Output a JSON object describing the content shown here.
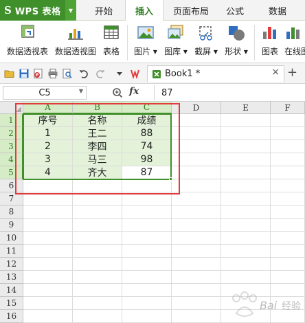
{
  "app": {
    "logo": "S",
    "name": "WPS 表格"
  },
  "tabs": [
    {
      "label": "开始"
    },
    {
      "label": "插入"
    },
    {
      "label": "页面布局"
    },
    {
      "label": "公式"
    },
    {
      "label": "数据"
    }
  ],
  "ribbon": {
    "pivot_table": "数据透视表",
    "pivot_chart": "数据透视图",
    "table": "表格",
    "picture": "图片",
    "gallery": "图库",
    "screenshot": "截屏",
    "shapes": "形状",
    "chart": "图表",
    "online": "在线图"
  },
  "document": {
    "tab_label": "Book1 *",
    "close": "×",
    "new_tab": "+"
  },
  "formula_bar": {
    "cell_ref": "C5",
    "fx": "fx",
    "value": "87"
  },
  "grid": {
    "columns": [
      "A",
      "B",
      "C",
      "D",
      "E",
      "F"
    ],
    "rows": [
      "1",
      "2",
      "3",
      "4",
      "5",
      "6",
      "7",
      "8",
      "9",
      "10",
      "11",
      "12",
      "13",
      "14",
      "15",
      "16"
    ],
    "table": [
      [
        "序号",
        "名称",
        "成绩"
      ],
      [
        "1",
        "王二",
        "88"
      ],
      [
        "2",
        "李四",
        "74"
      ],
      [
        "3",
        "马三",
        "98"
      ],
      [
        "4",
        "齐大",
        "87"
      ]
    ]
  },
  "colors": {
    "accent": "#3f8f2a",
    "selection_fill": "#e3f2d9",
    "annotation": "#e23b3b"
  }
}
